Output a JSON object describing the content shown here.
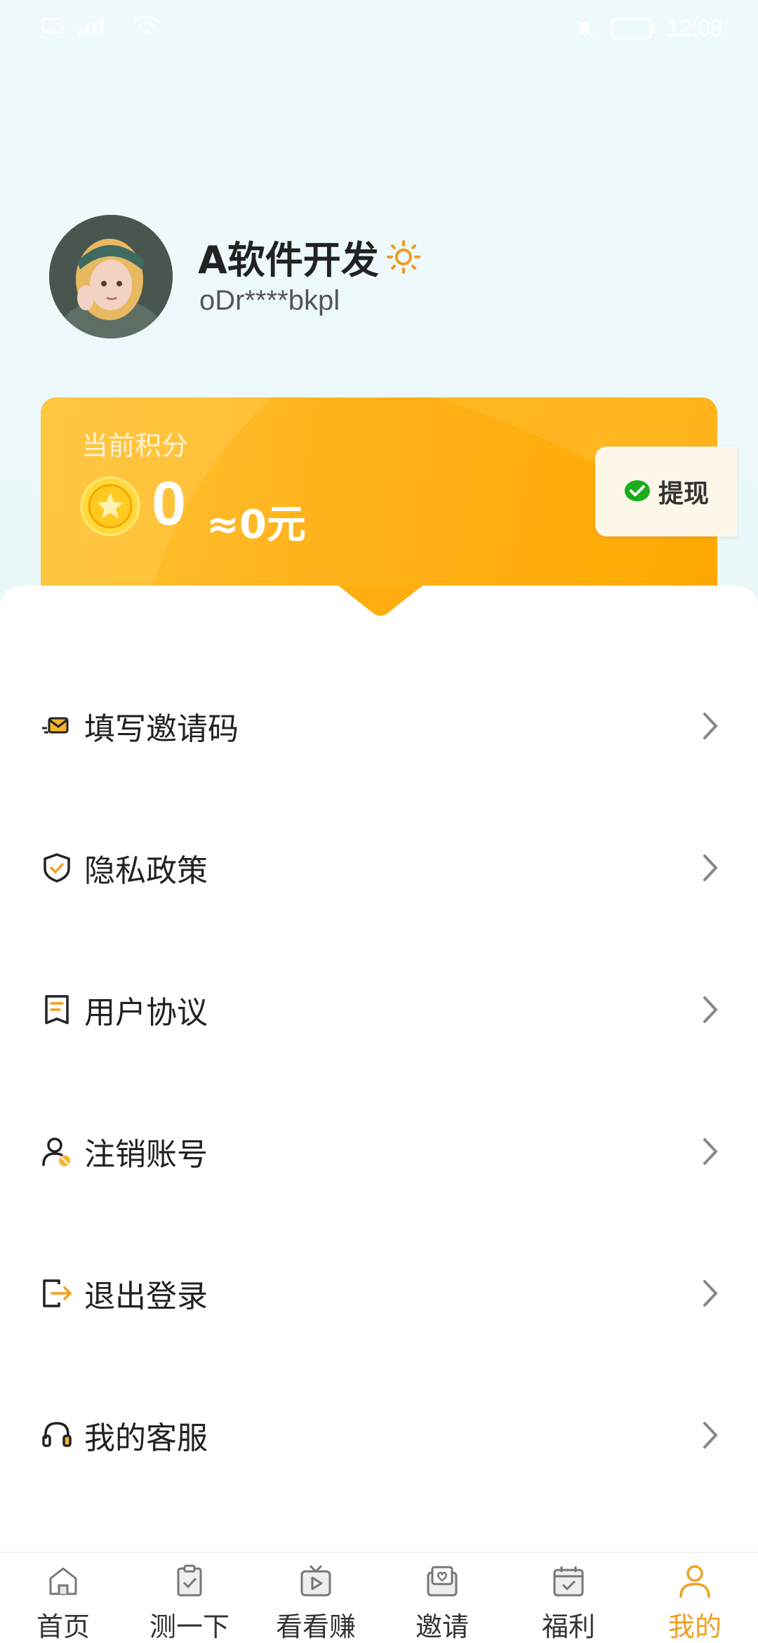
{
  "status_bar": {
    "time": "12:08"
  },
  "profile": {
    "name": "A软件开发",
    "user_id": "oDr****bkpl"
  },
  "points_card": {
    "label": "当前积分",
    "points": "0",
    "approx_value": "≈0元",
    "withdraw_label": "提现"
  },
  "menu": [
    {
      "label": "填写邀请码",
      "icon": "invite-code-icon"
    },
    {
      "label": "隐私政策",
      "icon": "shield-check-icon"
    },
    {
      "label": "用户协议",
      "icon": "document-icon"
    },
    {
      "label": "注销账号",
      "icon": "user-cancel-icon"
    },
    {
      "label": "退出登录",
      "icon": "logout-icon"
    },
    {
      "label": "我的客服",
      "icon": "headset-icon"
    }
  ],
  "bottom_nav": [
    {
      "label": "首页",
      "icon": "home-icon"
    },
    {
      "label": "测一下",
      "icon": "clipboard-check-icon"
    },
    {
      "label": "看看赚",
      "icon": "play-tv-icon"
    },
    {
      "label": "邀请",
      "icon": "invite-heart-icon"
    },
    {
      "label": "福利",
      "icon": "calendar-check-icon"
    },
    {
      "label": "我的",
      "icon": "user-icon",
      "active": true
    }
  ],
  "colors": {
    "accent": "#f0a020",
    "card": "#ffb21a",
    "background": "#eef9fa"
  }
}
